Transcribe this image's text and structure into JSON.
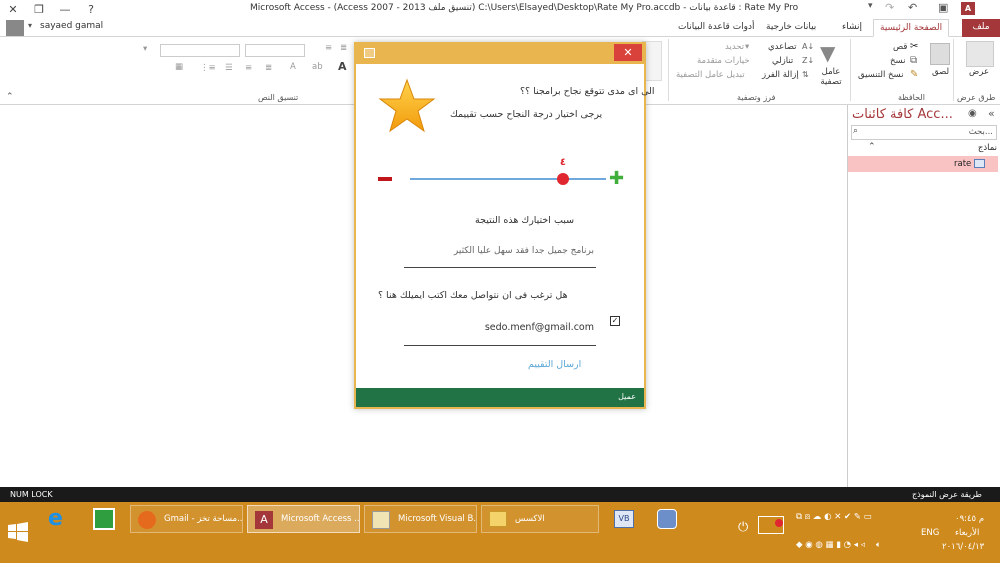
{
  "window": {
    "title": "Microsoft Access - (Access 2007 - 2013 تنسيق ملف) C:\\Users\\Elsayed\\Desktop\\Rate My Pro.accdb - قاعدة بيانات : Rate My Pro",
    "user": "sayaed gamal"
  },
  "tabs": {
    "file": "ملف",
    "home": "الصفحة الرئيسية",
    "create": "إنشاء",
    "external": "بيانات خارجية",
    "dbtools": "أدوات قاعدة البيانات"
  },
  "ribbon": {
    "views_label": "طرق عرض",
    "view_btn": "عرض",
    "clipboard_label": "الحافظة",
    "paste": "لصق",
    "cut": "قص",
    "copy": "نسخ",
    "format_painter": "نسخ التنسيق",
    "sort_label": "فرز وتصفية",
    "filter": "عامل تصفية",
    "ascending": "تصاعدي",
    "descending": "تنازلي",
    "remove_sort": "إزالة الفرز",
    "selection": "تحديد",
    "advanced": "خيارات متقدمة",
    "toggle_filter": "تبديل عامل التصفية",
    "text_format_label": "تنسيق النص"
  },
  "nav": {
    "title": "كافة كائنات Acc...",
    "search_placeholder": "بحث...",
    "group": "نماذج",
    "item": "rate"
  },
  "dialog": {
    "question": "الى اى مدى تتوقع نجاح برامجنا ؟؟",
    "instruction": "يرجى اختيار درجة النجاح حسب تقييمك",
    "rating_value": "٤",
    "rating_fraction": 0.78,
    "minus": "−",
    "plus": "+",
    "reason_label": "سبب اختيارك هذه النتيجة",
    "reason_value": "برنامج جميل جدا فقد سهل عليا الكثير",
    "contact_question": "هل ترغب فى ان نتواصل معك  اكتب ايميلك هنا  ؟",
    "email_value": "sedo.menf@gmail.com",
    "submit": "ارسال التقييم",
    "footer": "عميل"
  },
  "statusbar": {
    "left": "NUM LOCK",
    "right": "طريقة عرض النموذج"
  },
  "taskbar": {
    "items": [
      "Gmail - مساحة تخز...",
      "Microsoft Access ...",
      "Microsoft Visual B...",
      "الاكسس"
    ],
    "lang": "ENG",
    "time": "م ٠٩:٤٥",
    "day": "الأربعاء",
    "date": "٢٠١٦/٠٤/١٣"
  },
  "colors": {
    "access_red": "#a4373a",
    "dialog_border": "#e9b54f",
    "footer_green": "#217346",
    "taskbar": "#cf8a1e",
    "slider_blue": "#6fa8dc",
    "knob_red": "#e0262e"
  }
}
